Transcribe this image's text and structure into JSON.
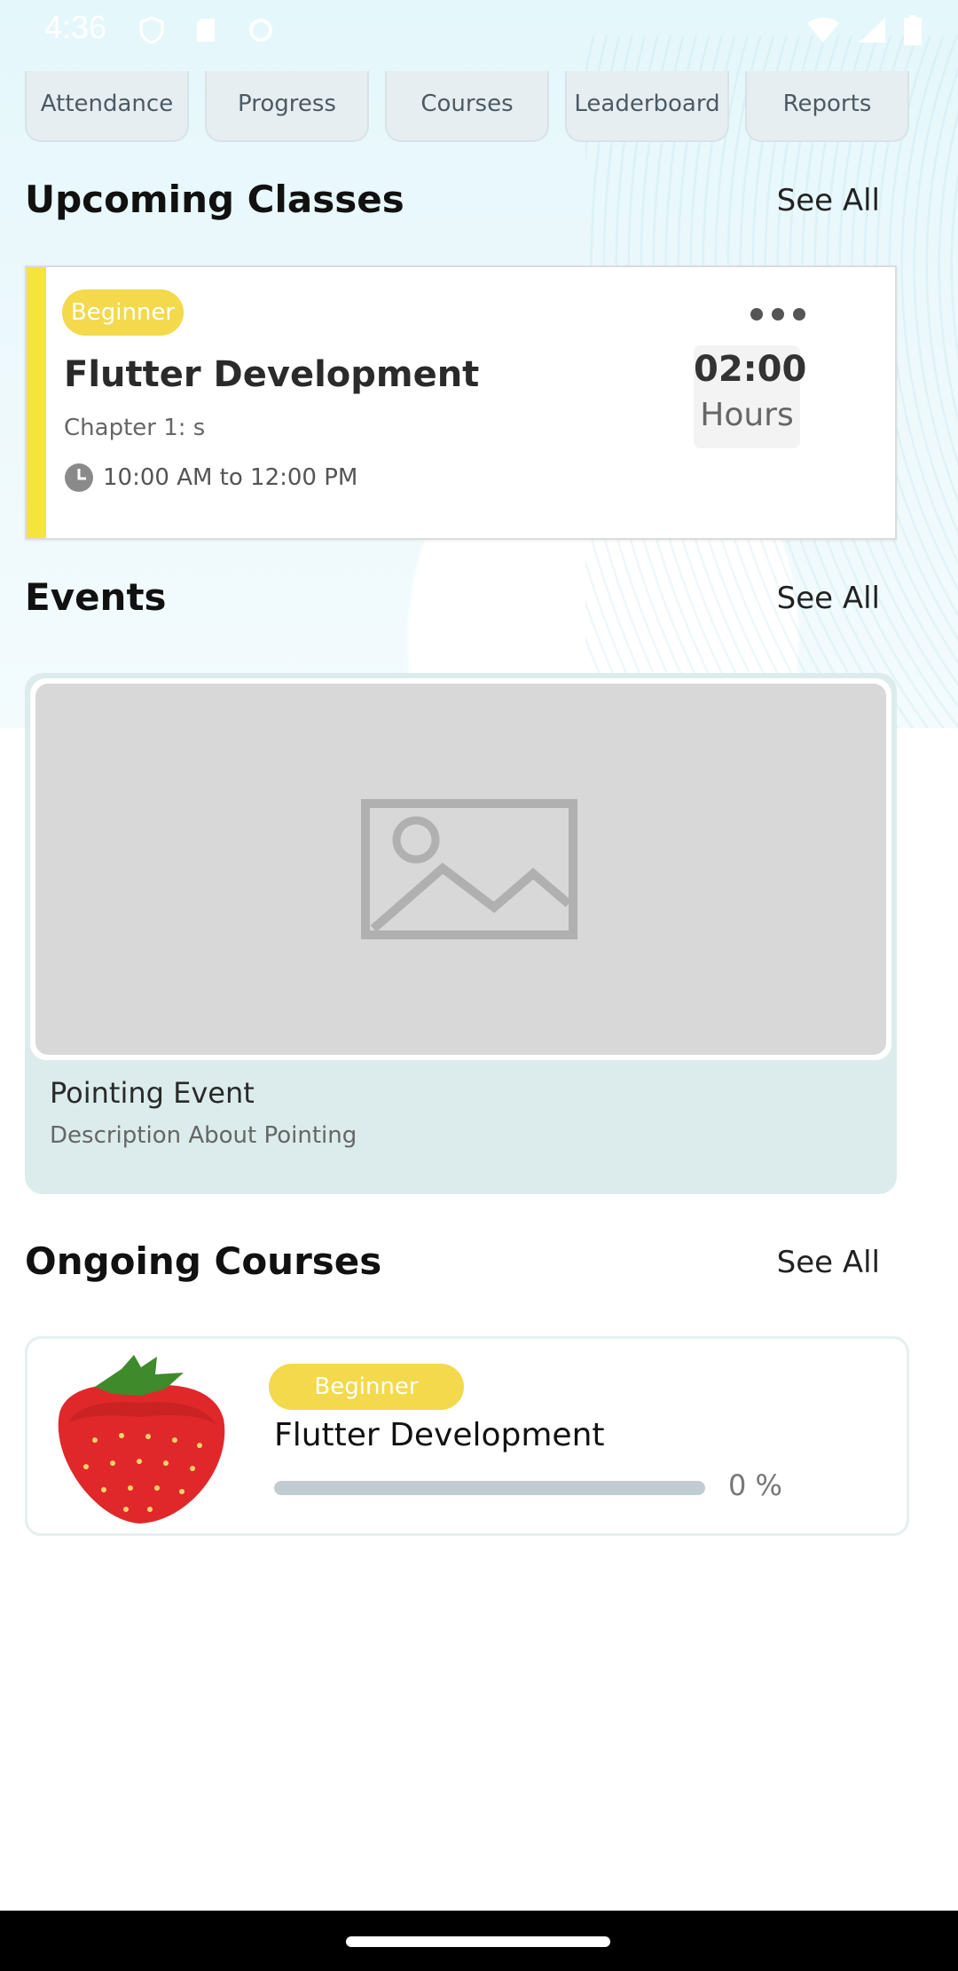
{
  "status_bar": {
    "time": "4:36"
  },
  "quick_actions": [
    "Attendance",
    "Progress",
    "Courses",
    "Leaderboard",
    "Reports"
  ],
  "upcoming_classes": {
    "title": "Upcoming Classes",
    "see_all": "See All",
    "card": {
      "level": "Beginner",
      "course": "Flutter Development",
      "chapter": "Chapter 1: s",
      "time_range": "10:00 AM to 12:00 PM",
      "duration_value": "02:00",
      "duration_unit": "Hours",
      "accent_color": "#f5e43a"
    }
  },
  "events": {
    "title": "Events",
    "see_all": "See All",
    "card": {
      "name": "Pointing Event",
      "description": "Description About Pointing"
    }
  },
  "ongoing_courses": {
    "title": "Ongoing Courses",
    "see_all": "See All",
    "card": {
      "level": "Beginner",
      "course": "Flutter Development",
      "progress_label": "0 %",
      "progress": 0
    }
  },
  "colors": {
    "badge": "#f3d94b",
    "event_bg": "#dcecec"
  }
}
